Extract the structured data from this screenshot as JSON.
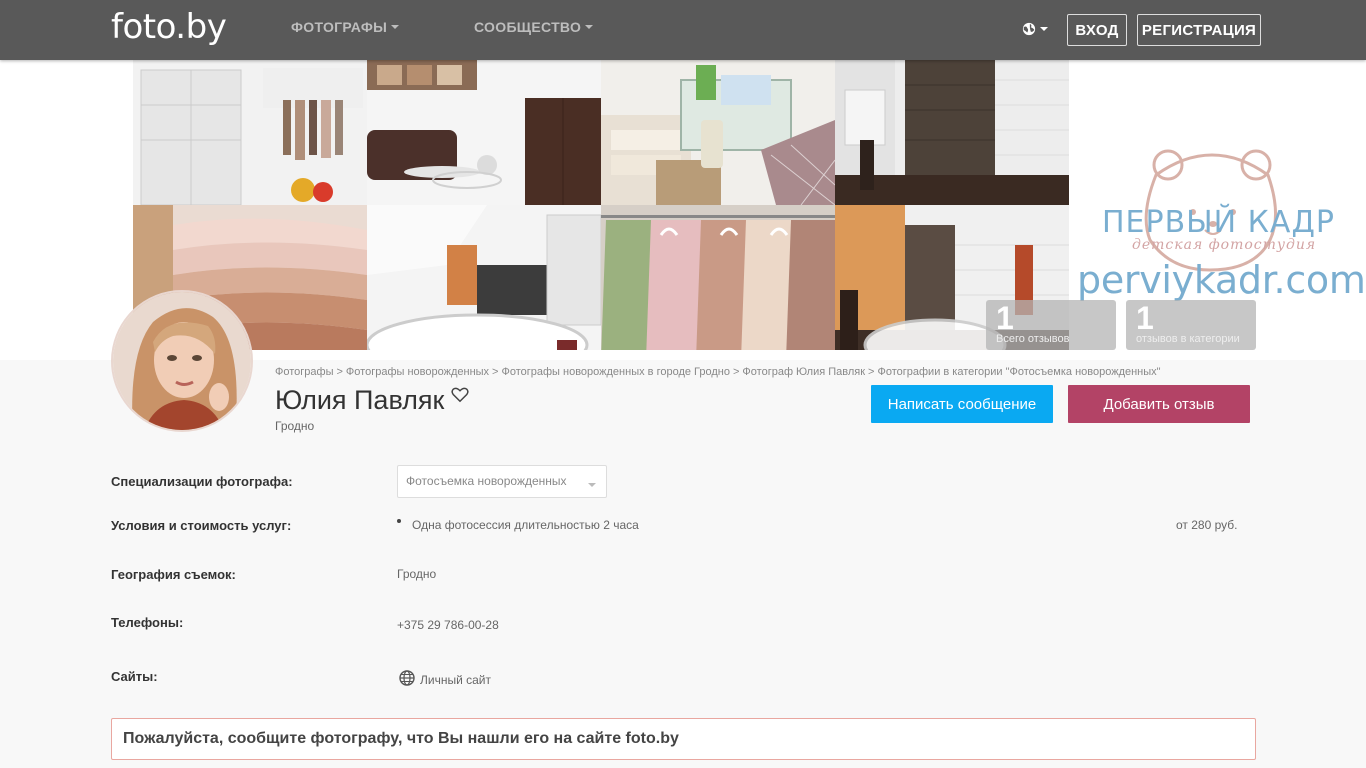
{
  "navbar": {
    "logo": "foto.by",
    "photographers": "ФОТОГРАФЫ",
    "community": "СООБЩЕСТВО",
    "language_icon": "globe-icon",
    "login": "ВХОД",
    "register": "РЕГИСТРАЦИЯ"
  },
  "cover": {
    "studio_name": "ПЕРВЫЙ КАДР",
    "studio_sub": "детская фотостудия",
    "studio_url": "perviykadr.com",
    "stats": [
      {
        "value": "1",
        "label": "Всего отзывов"
      },
      {
        "value": "1",
        "label": "отзывов в категории"
      }
    ]
  },
  "breadcrumb": [
    "Фотографы",
    "Фотографы новорожденных",
    "Фотографы новорожденных в городе Гродно",
    "Фотограф Юлия Павляк",
    "Фотографии в категории \"Фотосъемка новорожденных\""
  ],
  "profile": {
    "name": "Юлия Павляк",
    "city": "Гродно",
    "message_button": "Написать сообщение",
    "review_button": "Добавить отзыв"
  },
  "details": {
    "specialization_label": "Специализации фотографа:",
    "specialization_value": "Фотосъемка новорожденных",
    "services_label": "Условия и стоимость услуг:",
    "service_item": "Одна фотосессия длительностью 2 часа",
    "service_price": "от 280 руб.",
    "geo_label": "География съемок:",
    "geo_value": "Гродно",
    "phones_label": "Телефоны:",
    "phone_value": "+375 29 786-00-28",
    "sites_label": "Сайты:",
    "site_value": "Личный сайт"
  },
  "notice": "Пожалуйста, сообщите фотографу, что Вы нашли его на сайте foto.by",
  "colors": {
    "navbar": "#595959",
    "message_button": "#0aa9f2",
    "review_button": "#b34366"
  }
}
